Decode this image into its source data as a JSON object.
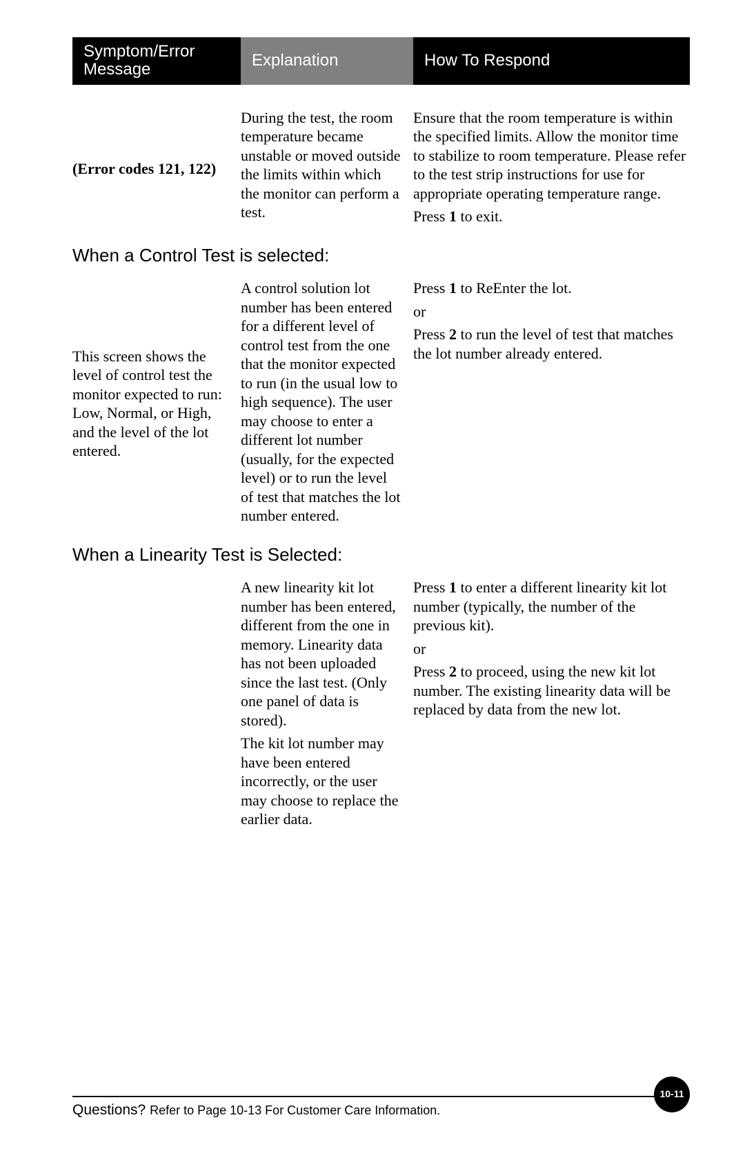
{
  "header": {
    "col1": "Symptom/Error Message",
    "col2": "Explanation",
    "col3": "How To Respond"
  },
  "row1": {
    "symptom": "(Error codes 121, 122)",
    "explanation": "During the test, the room temperature became unstable or moved outside the limits within which the monitor can perform a test.",
    "respond_p1": "Ensure that the room temperature is within the specified limits. Allow the monitor time to stabilize to room temperature. Please refer to the test strip instructions for use for appropriate operating temperature range.",
    "respond_p2_pre": "Press ",
    "respond_p2_bold": "1",
    "respond_p2_post": " to exit."
  },
  "section1_title": "When a Control Test is selected:",
  "row2": {
    "symptom": "This screen shows the level of control test the monitor expected to run: Low, Normal, or High, and the level of the lot entered.",
    "explanation": "A control solution lot number has been entered for a different level of control test from the one that the monitor expected to run (in the usual low to high sequence). The user may choose to enter a different lot number (usually, for the expected level) or to run the level of test that matches the lot number entered.",
    "respond_a_pre": "Press ",
    "respond_a_bold": "1",
    "respond_a_post": " to ReEnter the lot.",
    "respond_or": "or",
    "respond_b_pre": "Press ",
    "respond_b_bold": "2",
    "respond_b_post": " to run the level of test that matches the lot number already entered."
  },
  "section2_title": "When a Linearity Test is Selected:",
  "row3": {
    "symptom": "",
    "explanation_p1": "A new linearity kit lot number has been entered, different from the one in memory. Linearity data has not been uploaded since the last test. (Only one panel of data is stored).",
    "explanation_p2": "The kit lot number may have been entered incorrectly, or the user may choose to replace the earlier data.",
    "respond_a_pre": "Press ",
    "respond_a_bold": "1",
    "respond_a_post": " to enter a different linearity kit lot number (typically, the number of the previous kit).",
    "respond_or": "or",
    "respond_b_pre": "Press ",
    "respond_b_bold": "2",
    "respond_b_post": " to proceed, using the new kit lot number. The existing linearity data will be replaced by data from the new lot."
  },
  "footer": {
    "questions": "Questions? ",
    "ref": "Refer to Page 10-13 For Customer Care Information.",
    "page": "10-11"
  }
}
